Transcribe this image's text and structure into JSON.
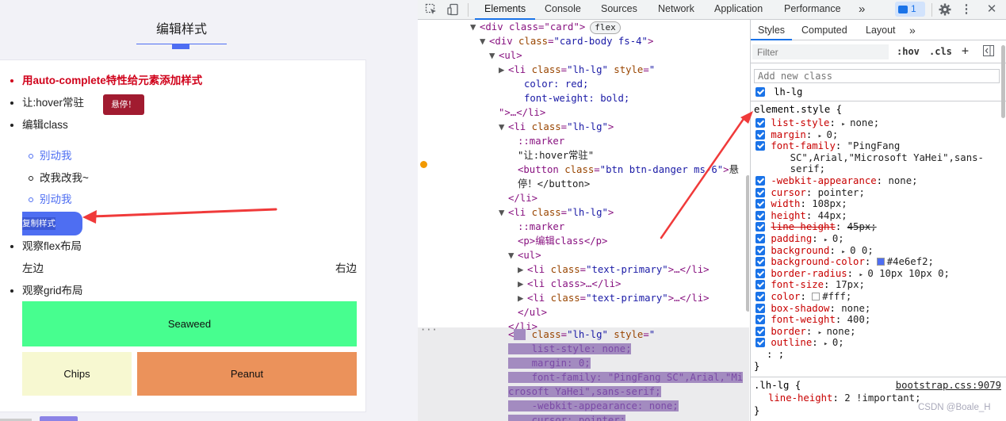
{
  "page": {
    "title": "编辑样式",
    "items": {
      "item1": "用auto-complete特性给元素添加样式",
      "item2": "让:hover常驻",
      "hover_button": "悬停！",
      "item3": "编辑class",
      "sub1": "别动我",
      "sub2": "改我改我~",
      "sub3": "别动我",
      "copy_button": "复制样式",
      "item4": "观察flex布局",
      "flex_left": "左边",
      "flex_right": "右边",
      "item5": "观察grid布局",
      "grid_1": "Seaweed",
      "grid_2": "Chips",
      "grid_3": "Peanut"
    }
  },
  "devtools": {
    "tabs": [
      "Elements",
      "Console",
      "Sources",
      "Network",
      "Application",
      "Performance"
    ],
    "more_tabs": "»",
    "issues_count": "1",
    "tree": {
      "r1": "<div class=\"card\">",
      "r1_badge": "flex",
      "r2_tag": "<div ",
      "r2_attr": "class",
      "r2_val": "\"card-body fs-4\"",
      "r3": "<ul>",
      "r4_attr": "class",
      "r4_val": "\"lh-lg\"",
      "r4_style": "style",
      "r5": "color: red;",
      "r6": "font-weight: bold;",
      "r7": "\">…</li>",
      "r8_val": "\"lh-lg\"",
      "r9": "::marker",
      "r10": "\"让:hover常驻\"",
      "r11_attr": "class",
      "r11_val": "\"btn btn-danger ms-6\"",
      "r11_text": "悬",
      "r12": "停！</button>",
      "r13": "</li>",
      "r14_val": "\"lh-lg\"",
      "r15": "::marker",
      "r16": "<p>编辑class</p>",
      "r17": "<ul>",
      "r18_val": "\"text-primary\"",
      "r19": "<li class>…</li>",
      "r20_val": "\"text-primary\"",
      "r21": "</ul>",
      "r22": "</li>",
      "r23_val": "\"lh-lg\"",
      "r24": "list-style: none;",
      "r25": "margin: 0;",
      "r26": "font-family: \"PingFang SC\",Arial,\"Mi",
      "r27": "crosoft YaHei\",sans-serif;",
      "r28": "-webkit-appearance: none;",
      "r29": "cursor: pointer;"
    },
    "styles": {
      "subtabs": [
        "Styles",
        "Computed",
        "Layout"
      ],
      "subtabs_more": "»",
      "filter_placeholder": "Filter",
      "hov": ":hov",
      "cls": ".cls",
      "add_class_placeholder": "Add new class",
      "class_name": "lh-lg",
      "element_style": "element.style {",
      "declarations": [
        {
          "name": "list-style",
          "value": "none;",
          "arrow": true
        },
        {
          "name": "margin",
          "value": "0;",
          "arrow": true
        },
        {
          "name": "font-family",
          "value": "\"PingFang"
        },
        {
          "name": "",
          "value": "    SC\",Arial,\"Microsoft YaHei\",sans-"
        },
        {
          "name": "",
          "value": "    serif;"
        },
        {
          "name": "-webkit-appearance",
          "value": "none;"
        },
        {
          "name": "cursor",
          "value": "pointer;"
        },
        {
          "name": "width",
          "value": "108px;"
        },
        {
          "name": "height",
          "value": "44px;"
        },
        {
          "name": "line-height",
          "value": "45px;",
          "strike": true
        },
        {
          "name": "padding",
          "value": "0;",
          "arrow": true
        },
        {
          "name": "background",
          "value": "0 0;",
          "arrow": true
        },
        {
          "name": "background-color",
          "value": "#4e6ef2;",
          "swatch": "#4e6ef2"
        },
        {
          "name": "border-radius",
          "value": "0 10px 10px 0;",
          "arrow": true
        },
        {
          "name": "font-size",
          "value": "17px;"
        },
        {
          "name": "color",
          "value": "#fff;",
          "swatch": "#ffffff"
        },
        {
          "name": "box-shadow",
          "value": "none;"
        },
        {
          "name": "font-weight",
          "value": "400;"
        },
        {
          "name": "border",
          "value": "none;",
          "arrow": true
        },
        {
          "name": "outline",
          "value": "0;",
          "arrow": true
        }
      ],
      "new_decl": ": ;",
      "close_brace": "}",
      "lh_rule": ".lh-lg {",
      "lh_source": "bootstrap.css:9079",
      "lh_decl_name": "line-height",
      "lh_decl_value": "2 !important;",
      "lh_close": "}"
    }
  },
  "watermark": "CSDN @Boale_H",
  "colors": {
    "accent": "#4e6ef2",
    "danger": "#a11b30",
    "red_text": "#d0021b",
    "seaweed": "#47fe8f",
    "chips": "#f7f8d1",
    "peanut": "#eb925b",
    "arrow": "#f03a3a"
  }
}
